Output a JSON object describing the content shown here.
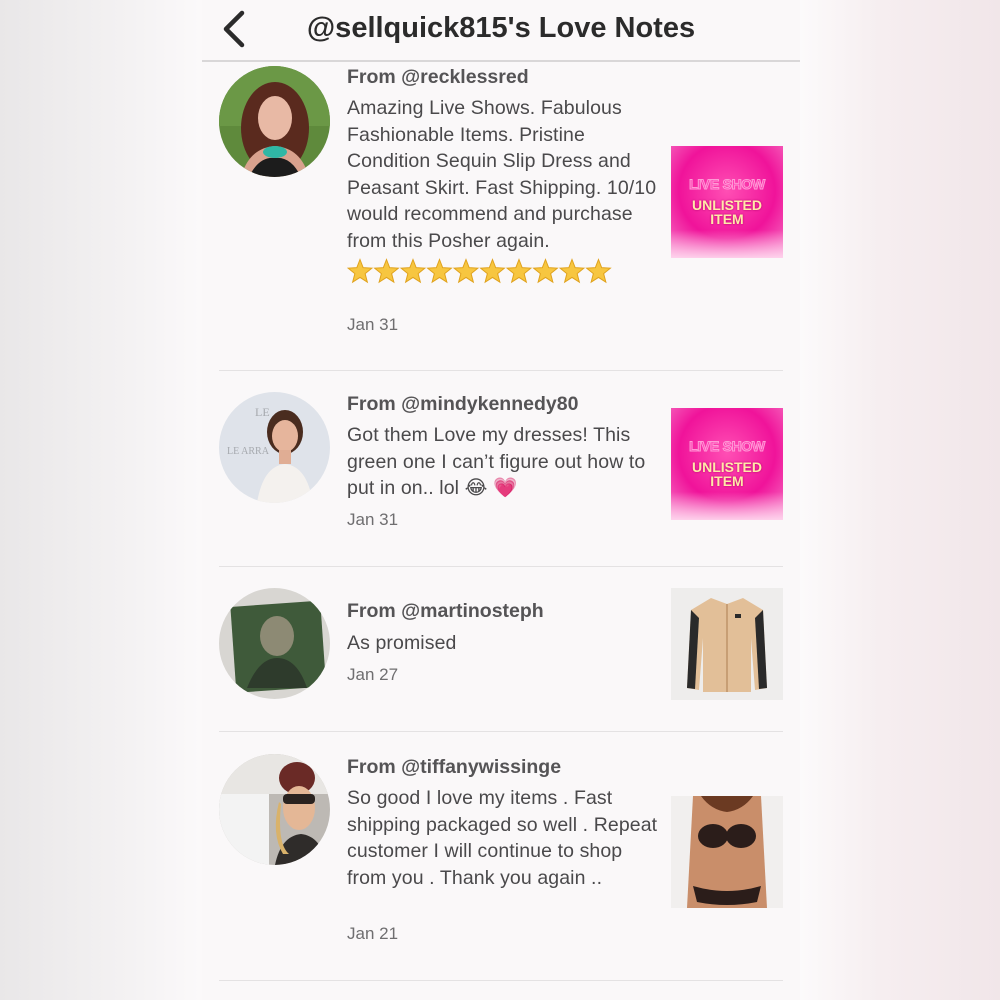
{
  "header": {
    "back_icon": "chevron-left-icon",
    "title": "@sellquick815's Love Notes"
  },
  "notes": [
    {
      "from": "From @recklessred",
      "text": "Amazing Live Shows. Fabulous Fashionable Items. Pristine Condition Sequin Slip Dress and Peasant Skirt. Fast Shipping. 10/10 would recommend and purchase from this Posher again.",
      "stars": 10,
      "date": "Jan 31",
      "thumb": {
        "type": "promo",
        "line1": "LIVE SHOW",
        "line2": "UNLISTED",
        "line3": "ITEM"
      }
    },
    {
      "from": "From @mindykennedy80",
      "text": "Got them Love my dresses! This green one I can’t figure out how to put in on.. lol 😂 💗",
      "date": "Jan 31",
      "thumb": {
        "type": "promo",
        "line1": "LIVE SHOW",
        "line2": "UNLISTED",
        "line3": "ITEM"
      }
    },
    {
      "from": "From @martinosteph",
      "text": "As promised",
      "date": "Jan 27",
      "thumb": {
        "type": "jacket"
      }
    },
    {
      "from": "From @tiffanywissinge",
      "text": "So good I love my items . Fast shipping packaged so well . Repeat customer I will continue to shop from you . Thank you again ..",
      "date": "Jan 21",
      "thumb": {
        "type": "swimwear"
      }
    }
  ]
}
